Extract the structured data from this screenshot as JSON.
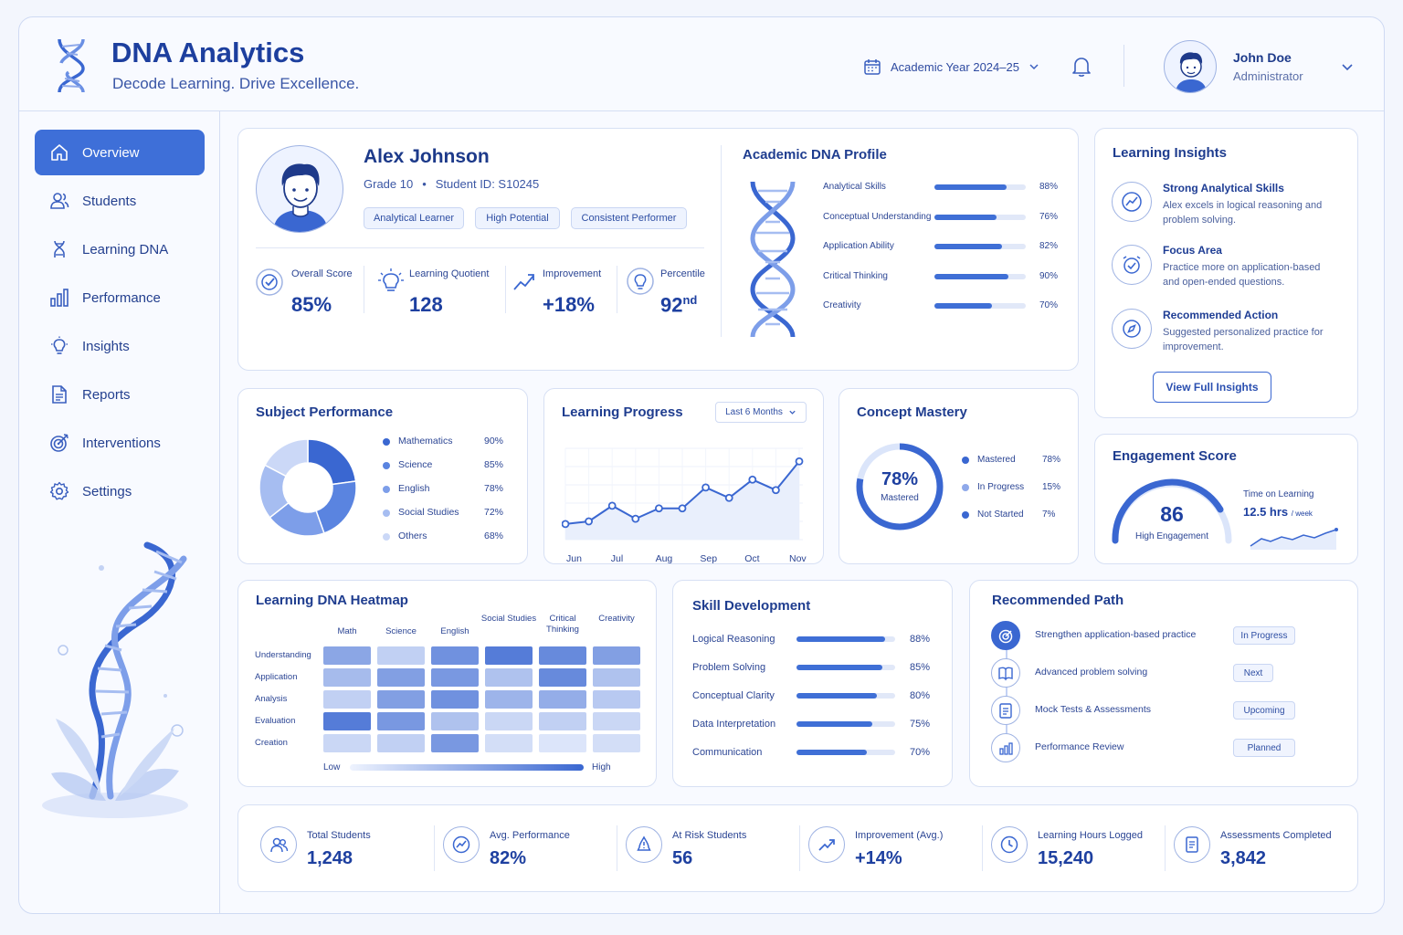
{
  "header": {
    "brand": "DNA Analytics",
    "tagline": "Decode Learning. Drive Excellence.",
    "year_selector": "Academic Year 2024–25",
    "user_name": "John Doe",
    "user_role": "Administrator"
  },
  "sidebar": {
    "items": [
      {
        "label": "Overview",
        "icon": "home-icon"
      },
      {
        "label": "Students",
        "icon": "users-icon"
      },
      {
        "label": "Learning DNA",
        "icon": "dna-icon"
      },
      {
        "label": "Performance",
        "icon": "bar-chart-icon"
      },
      {
        "label": "Insights",
        "icon": "lightbulb-icon"
      },
      {
        "label": "Reports",
        "icon": "document-icon"
      },
      {
        "label": "Interventions",
        "icon": "target-icon"
      },
      {
        "label": "Settings",
        "icon": "gear-icon"
      }
    ]
  },
  "student": {
    "name": "Alex Johnson",
    "grade": "Grade 10",
    "id": "Student ID: S10245",
    "tags": [
      "Analytical Learner",
      "High Potential",
      "Consistent Performer"
    ],
    "stats": [
      {
        "label": "Overall Score",
        "value": "85%"
      },
      {
        "label": "Learning Quotient",
        "value": "128"
      },
      {
        "label": "Improvement",
        "value": "+18%"
      },
      {
        "label": "Percentile",
        "value": "92",
        "sup": "nd"
      }
    ]
  },
  "dna_profile": {
    "title": "Academic DNA Profile",
    "skills": [
      {
        "label": "Analytical Skills",
        "value": "88%",
        "pct": 88
      },
      {
        "label": "Conceptual Understanding",
        "value": "76%",
        "pct": 76
      },
      {
        "label": "Application Ability",
        "value": "82%",
        "pct": 82
      },
      {
        "label": "Critical Thinking",
        "value": "90%",
        "pct": 90
      },
      {
        "label": "Creativity",
        "value": "70%",
        "pct": 70
      }
    ]
  },
  "insights": {
    "title": "Learning Insights",
    "items": [
      {
        "title": "Strong Analytical Skills",
        "desc": "Alex excels in logical reasoning and problem solving."
      },
      {
        "title": "Focus Area",
        "desc": "Practice more on application-based and open-ended questions."
      },
      {
        "title": "Recommended Action",
        "desc": "Suggested personalized practice for improvement."
      }
    ],
    "button": "View Full Insights"
  },
  "subject_performance": {
    "title": "Subject Performance",
    "items": [
      {
        "label": "Mathematics",
        "value": "90%",
        "color": "#3a67d1"
      },
      {
        "label": "Science",
        "value": "85%",
        "color": "#5a84e0"
      },
      {
        "label": "English",
        "value": "78%",
        "color": "#7d9ee9"
      },
      {
        "label": "Social Studies",
        "value": "72%",
        "color": "#a6bdf1"
      },
      {
        "label": "Others",
        "value": "68%",
        "color": "#cbd8f7"
      }
    ]
  },
  "learning_progress": {
    "title": "Learning Progress",
    "range": "Last 6 Months",
    "months": [
      "Jun",
      "Jul",
      "Aug",
      "Sep",
      "Oct",
      "Nov"
    ]
  },
  "chart_data": {
    "type": "line",
    "x": [
      "Jun",
      "",
      "Jul",
      "",
      "Aug",
      "",
      "Sep",
      "",
      "Oct",
      "",
      "Nov"
    ],
    "values": [
      66,
      67,
      73,
      68,
      72,
      72,
      80,
      76,
      83,
      79,
      90
    ],
    "ylim": [
      60,
      95
    ]
  },
  "concept_mastery": {
    "title": "Concept Mastery",
    "center_value": "78%",
    "center_label": "Mastered",
    "items": [
      {
        "label": "Mastered",
        "value": "78%",
        "color": "#3a67d1"
      },
      {
        "label": "In Progress",
        "value": "15%",
        "color": "#8fa9ea"
      },
      {
        "label": "Not Started",
        "value": "7%",
        "color": "#3a67d1"
      }
    ]
  },
  "engagement": {
    "title": "Engagement Score",
    "score": "86",
    "score_label": "High Engagement",
    "time_label": "Time on Learning",
    "time_value": "12.5 hrs",
    "time_unit": "/ week"
  },
  "heatmap": {
    "title": "Learning DNA Heatmap",
    "cols": [
      "Math",
      "Science",
      "English",
      "Social Studies",
      "Critical Thinking",
      "Creativity"
    ],
    "rows": [
      "Understanding",
      "Application",
      "Analysis",
      "Evaluation",
      "Creation"
    ],
    "cells": [
      [
        0.55,
        0.25,
        0.7,
        0.85,
        0.75,
        0.6
      ],
      [
        0.4,
        0.6,
        0.65,
        0.35,
        0.75,
        0.35
      ],
      [
        0.25,
        0.6,
        0.7,
        0.45,
        0.5,
        0.3
      ],
      [
        0.85,
        0.65,
        0.35,
        0.2,
        0.25,
        0.2
      ],
      [
        0.2,
        0.25,
        0.65,
        0.15,
        0.1,
        0.15
      ]
    ],
    "low": "Low",
    "high": "High"
  },
  "skill_development": {
    "title": "Skill Development",
    "items": [
      {
        "label": "Logical Reasoning",
        "value": "88%",
        "pct": 88
      },
      {
        "label": "Problem Solving",
        "value": "85%",
        "pct": 85
      },
      {
        "label": "Conceptual Clarity",
        "value": "80%",
        "pct": 80
      },
      {
        "label": "Data Interpretation",
        "value": "75%",
        "pct": 75
      },
      {
        "label": "Communication",
        "value": "70%",
        "pct": 70
      }
    ]
  },
  "recommended_path": {
    "title": "Recommended Path",
    "items": [
      {
        "label": "Strengthen application-based practice",
        "status": "In Progress",
        "icon": "target-icon"
      },
      {
        "label": "Advanced problem solving",
        "status": "Next",
        "icon": "book-icon"
      },
      {
        "label": "Mock Tests & Assessments",
        "status": "Upcoming",
        "icon": "checklist-icon"
      },
      {
        "label": "Performance Review",
        "status": "Planned",
        "icon": "chart-icon"
      }
    ]
  },
  "bottom_stats": [
    {
      "label": "Total Students",
      "value": "1,248",
      "icon": "users-icon"
    },
    {
      "label": "Avg. Performance",
      "value": "82%",
      "icon": "gauge-icon"
    },
    {
      "label": "At Risk Students",
      "value": "56",
      "icon": "warning-icon"
    },
    {
      "label": "Improvement (Avg.)",
      "value": "+14%",
      "icon": "trend-up-icon"
    },
    {
      "label": "Learning Hours Logged",
      "value": "15,240",
      "icon": "clock-icon"
    },
    {
      "label": "Assessments Completed",
      "value": "3,842",
      "icon": "document-icon"
    }
  ]
}
